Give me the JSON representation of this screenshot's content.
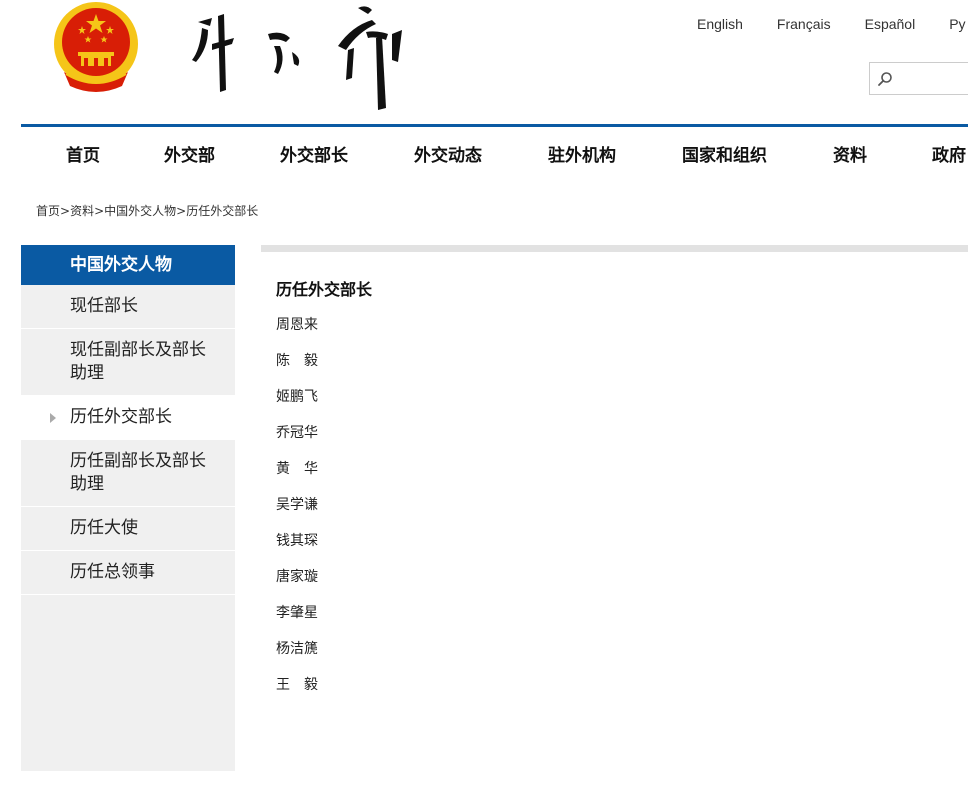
{
  "header": {
    "languages": [
      "English",
      "Français",
      "Español",
      "Ру"
    ],
    "search": {
      "placeholder": ""
    }
  },
  "nav": {
    "items": [
      "首页",
      "外交部",
      "外交部长",
      "外交动态",
      "驻外机构",
      "国家和组织",
      "资料",
      "政府"
    ]
  },
  "breadcrumb": {
    "items": [
      "首页",
      "资料",
      "中国外交人物",
      "历任外交部长"
    ],
    "separator": ">"
  },
  "sidebar": {
    "title": "中国外交人物",
    "items": [
      {
        "label": "现任部长"
      },
      {
        "label": "现任副部长及部长助理"
      },
      {
        "label": "历任外交部长",
        "active": true
      },
      {
        "label": "历任副部长及部长助理"
      },
      {
        "label": "历任大使"
      },
      {
        "label": "历任总领事"
      }
    ]
  },
  "content": {
    "title": "历任外交部长",
    "ministers": [
      "周恩来",
      "陈　毅",
      "姬鹏飞",
      "乔冠华",
      "黄　华",
      "吴学谦",
      "钱其琛",
      "唐家璇",
      "李肇星",
      "杨洁篪",
      "王　毅"
    ]
  },
  "colors": {
    "brand_blue": "#0a5aa3",
    "sidebar_bg": "#f0f0f0",
    "emblem_red": "#d81e06",
    "emblem_gold": "#f5c518"
  }
}
